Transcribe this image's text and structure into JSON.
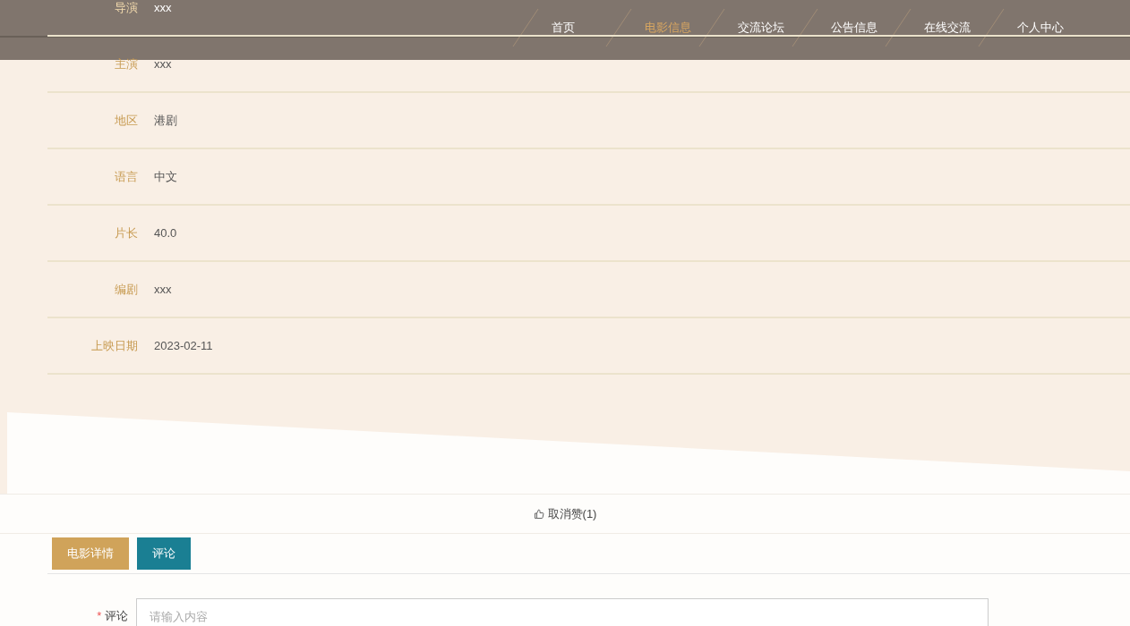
{
  "nav": [
    {
      "label": "首页",
      "selected": false
    },
    {
      "label": "电影信息",
      "selected": true
    },
    {
      "label": "交流论坛",
      "selected": false
    },
    {
      "label": "公告信息",
      "selected": false
    },
    {
      "label": "在线交流",
      "selected": false
    },
    {
      "label": "个人中心",
      "selected": false
    }
  ],
  "details": [
    {
      "label": "导演",
      "value": "xxx"
    },
    {
      "label": "主演",
      "value": "xxx"
    },
    {
      "label": "地区",
      "value": "港剧"
    },
    {
      "label": "语言",
      "value": "中文"
    },
    {
      "label": "片长",
      "value": "40.0"
    },
    {
      "label": "编剧",
      "value": "xxx"
    },
    {
      "label": "上映日期",
      "value": "2023-02-11"
    }
  ],
  "like": {
    "label": "取消赞(1)"
  },
  "tabs": [
    {
      "label": "电影详情",
      "selected": false
    },
    {
      "label": "评论",
      "selected": true
    }
  ],
  "comment_form": {
    "required_mark": "*",
    "label": "评论",
    "placeholder": "请输入内容"
  }
}
